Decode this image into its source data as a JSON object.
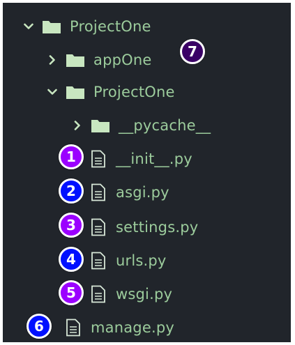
{
  "colors": {
    "background": "#21252b",
    "text": "#9ccc9c",
    "folder": "#c8e6c0",
    "file_outline": "#d8e8d8",
    "badge_purple": "#9b00ff",
    "badge_blue": "#0010ff",
    "badge_dark_purple": "#3a0066"
  },
  "tree": {
    "root": {
      "label": "ProjectOne",
      "icon": "folder-icon",
      "expanded": true
    },
    "app_one": {
      "label": "appOne",
      "icon": "folder-icon",
      "expanded": false
    },
    "project_one": {
      "label": "ProjectOne",
      "icon": "folder-icon",
      "expanded": true
    },
    "pycache": {
      "label": "__pycache__",
      "icon": "folder-icon",
      "expanded": false
    },
    "init": {
      "label": "__init__.py",
      "icon": "file-icon"
    },
    "asgi": {
      "label": "asgi.py",
      "icon": "file-icon"
    },
    "settings": {
      "label": "settings.py",
      "icon": "file-icon"
    },
    "urls": {
      "label": "urls.py",
      "icon": "file-icon"
    },
    "wsgi": {
      "label": "wsgi.py",
      "icon": "file-icon"
    },
    "manage": {
      "label": "manage.py",
      "icon": "file-icon"
    }
  },
  "badges": {
    "b1": "1",
    "b2": "2",
    "b3": "3",
    "b4": "4",
    "b5": "5",
    "b6": "6",
    "b7": "7"
  }
}
